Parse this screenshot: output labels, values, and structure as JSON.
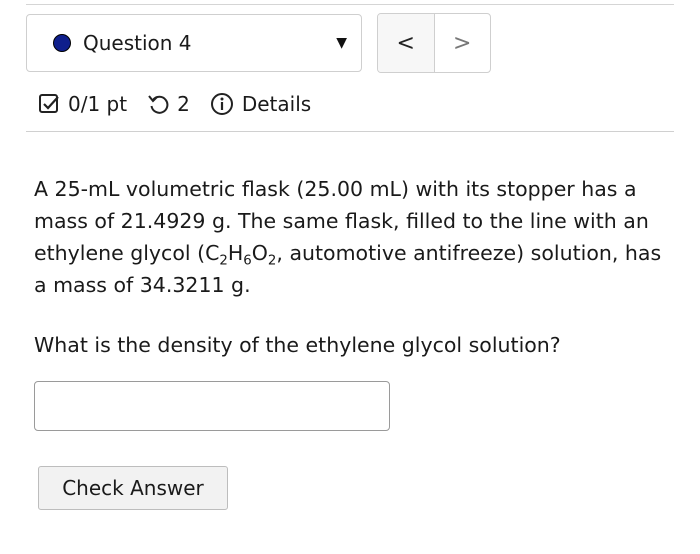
{
  "question_selector": {
    "label": "Question 4",
    "status_color": "#0f1f8c"
  },
  "nav": {
    "prev_glyph": "<",
    "next_glyph": ">"
  },
  "meta": {
    "score": "0/1 pt",
    "attempts": "2",
    "details_label": "Details"
  },
  "problem": {
    "text_1": "A 25-mL volumetric flask (25.00 mL) with its stopper has a mass of 21.4929 g. The same flask, filled to the line with an ethylene glycol (C",
    "sub_1": "2",
    "text_2": "H",
    "sub_2": "6",
    "text_3": "O",
    "sub_3": "2",
    "text_4": ", automotive antifreeze) solution, has a mass of 34.3211 g."
  },
  "question_text": "What is the density of the ethylene glycol solution?",
  "answer_input": {
    "value": "",
    "placeholder": ""
  },
  "check_button_label": "Check Answer"
}
